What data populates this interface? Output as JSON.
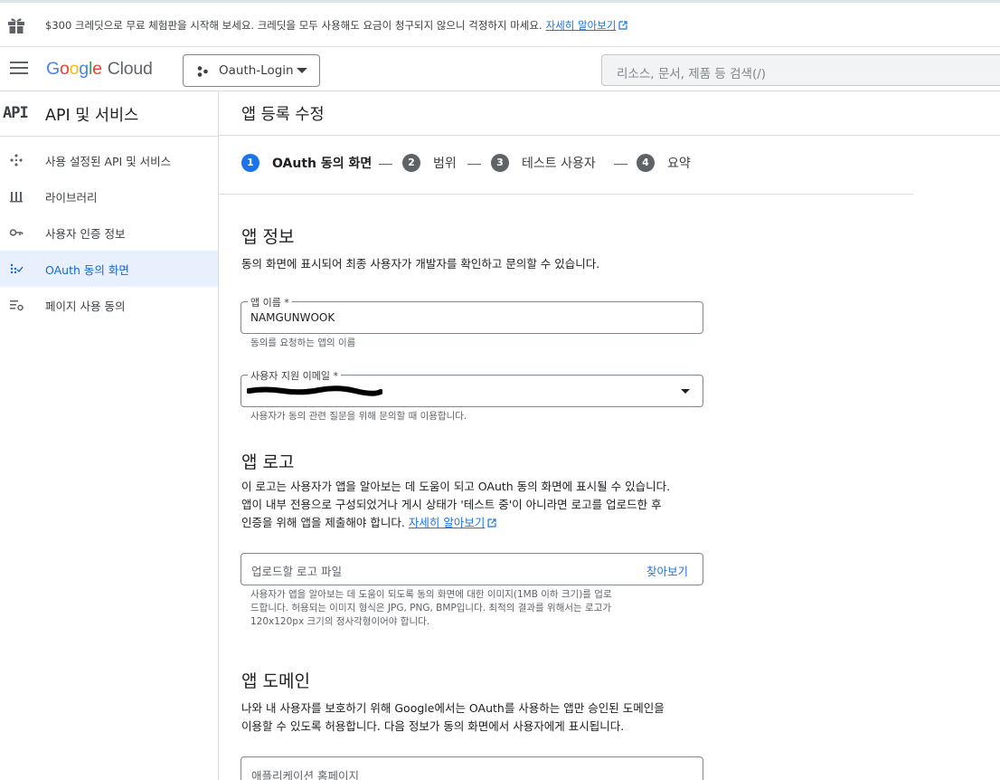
{
  "banner": {
    "text": "$300 크레딧으로 무료 체험판을 시작해 보세요. 크레딧을 모두 사용해도 요금이 청구되지 않으니 걱정하지 마세요.",
    "link": "자세히 알아보기"
  },
  "header": {
    "logo": {
      "g1": "G",
      "o1": "o",
      "o2": "o",
      "g2": "g",
      "l": "l",
      "e": "e",
      "cloud": "Cloud"
    },
    "project": "Oauth-Login",
    "search_placeholder": "리소스, 문서, 제품 등 검색(/)"
  },
  "sidebar": {
    "api_label": "API",
    "title": "API 및 서비스",
    "items": [
      {
        "label": "사용 설정된 API 및 서비스",
        "icon": "api-services-icon"
      },
      {
        "label": "라이브러리",
        "icon": "library-icon"
      },
      {
        "label": "사용자 인증 정보",
        "icon": "key-icon"
      },
      {
        "label": "OAuth 동의 화면",
        "icon": "consent-icon",
        "active": true
      },
      {
        "label": "페이지 사용 동의",
        "icon": "page-usage-icon"
      }
    ]
  },
  "main": {
    "title": "앱 등록 수정",
    "steps": [
      {
        "num": "1",
        "label": "OAuth 동의 화면"
      },
      {
        "num": "2",
        "label": "범위"
      },
      {
        "num": "3",
        "label": "테스트 사용자"
      },
      {
        "num": "4",
        "label": "요약"
      }
    ],
    "app_info": {
      "heading": "앱 정보",
      "desc": "동의 화면에 표시되어 최종 사용자가 개발자를 확인하고 문의할 수 있습니다.",
      "app_name_label": "앱 이름 *",
      "app_name_value": "NAMGUNWOOK",
      "app_name_hint": "동의를 요청하는 앱의 이름",
      "email_label": "사용자 지원 이메일 *",
      "email_hint": "사용자가 동의 관련 질문을 위해 문의할 때 이용합니다."
    },
    "app_logo": {
      "heading": "앱 로고",
      "desc1": "이 로고는 사용자가 앱을 알아보는 데 도움이 되고 OAuth 동의 화면에 표시될 수 있습니다.",
      "desc2": "앱이 내부 전용으로 구성되었거나 게시 상태가 '테스트 중'이 아니라면 로고를 업로드한 후",
      "desc3": "인증을 위해 앱을 제출해야 합니다.",
      "learn_more": "자세히 알아보기",
      "upload_placeholder": "업로드할 로고 파일",
      "browse": "찾아보기",
      "hint1": "사용자가 앱을 알아보는 데 도움이 되도록 동의 화면에 대한 이미지(1MB 이하 크기)를 업로",
      "hint2": "드합니다. 허용되는 이미지 형식은 JPG, PNG, BMP입니다. 최적의 결과를 위해서는 로고가",
      "hint3": "120x120px 크기의 정사각형이어야 합니다."
    },
    "app_domain": {
      "heading": "앱 도메인",
      "desc1": "나와 내 사용자를 보호하기 위해 Google에서는 OAuth를 사용하는 앱만 승인된 도메인을",
      "desc2": "이용할 수 있도록 허용합니다. 다음 정보가 동의 화면에서 사용자에게 표시됩니다.",
      "homepage_placeholder": "애플리케이션 홈페이지"
    }
  },
  "colors": {
    "accent": "#1a73e8",
    "active_bg": "#e8f0fe"
  }
}
